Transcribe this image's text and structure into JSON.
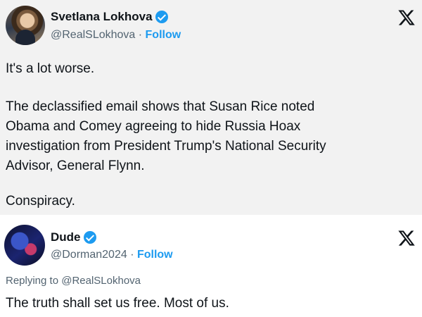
{
  "main_tweet": {
    "author_name": "Svetlana Lokhova",
    "handle": "@RealSLokhova",
    "separator": " · ",
    "follow_label": "Follow",
    "text_line1": "It's a lot worse.",
    "text_paragraph2": "The declassified email shows that Susan Rice noted\nObama and Comey agreeing to hide Russia Hoax\ninvestigation from President Trump's National Security\nAdvisor, General Flynn.",
    "text_line3": "Conspiracy."
  },
  "reply_tweet": {
    "author_name": "Dude",
    "handle": "@Dorman2024",
    "separator": " · ",
    "follow_label": "Follow",
    "replying_prefix": "Replying to ",
    "replying_to": "@RealSLokhova",
    "text": "The truth shall set us free. Most of us."
  },
  "icons": {
    "platform_logo": "x-logo-icon",
    "verified": "verified-badge-icon"
  },
  "colors": {
    "accent": "#1d9bf0",
    "main_background": "#f2f2f2",
    "reply_background": "#ffffff",
    "text_primary": "#0f1419",
    "text_secondary": "#536471"
  }
}
